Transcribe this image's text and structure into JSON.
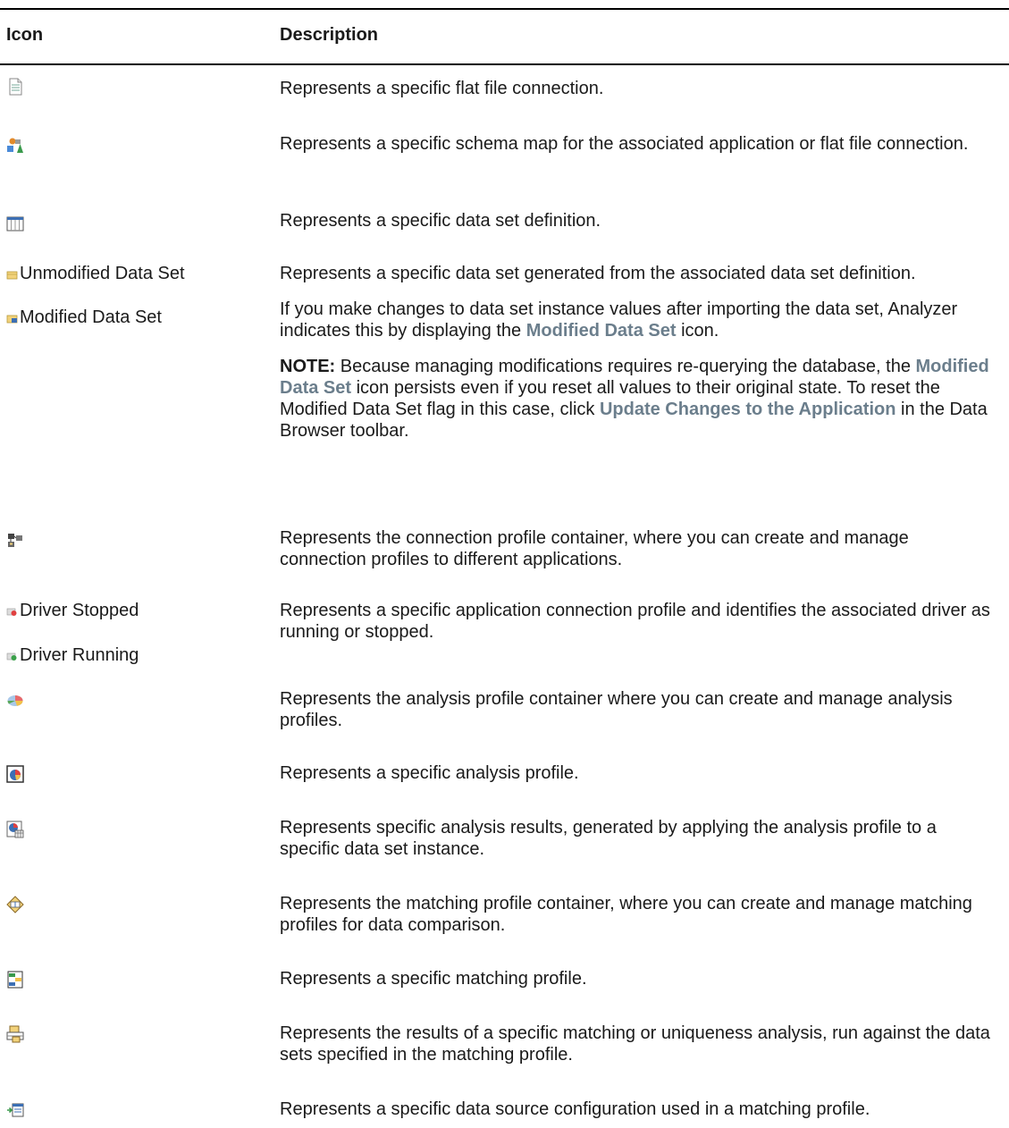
{
  "header": {
    "icon": "Icon",
    "description": "Description"
  },
  "rows": [
    {
      "icon": "flat-file-connection-icon",
      "description": "Represents a specific flat file connection."
    },
    {
      "icon": "schema-map-icon",
      "description": "Represents a specific schema map for the associated application or flat file connection."
    },
    {
      "icon": "data-set-definition-icon",
      "description": "Represents a specific data set definition."
    },
    {
      "labels": [
        "Unmodified Data Set",
        "Modified Data Set"
      ],
      "description": "Represents a specific data set generated from the associated data set definition.",
      "para2": {
        "before": "If you make changes to data set instance values after importing the data set, Analyzer indicates this by displaying the ",
        "link": "Modified Data Set",
        "after": " icon."
      },
      "note": {
        "label": "NOTE:",
        "t1": " Because managing modifications requires re-querying the database, the ",
        "link1": "Modified Data Set",
        "t2": " icon persists even if you reset all values to their original state. To reset the Modified Data Set flag in this case, click ",
        "link2": "Update Changes to the Application",
        "t3": " in the Data Browser toolbar."
      }
    },
    {
      "icon": "connection-profile-container-icon",
      "description": "Represents the connection profile container, where you can create and manage connection profiles to different applications."
    },
    {
      "labels": [
        "Driver Stopped",
        "Driver Running"
      ],
      "description": "Represents a specific application connection profile and identifies the associated driver as running or stopped."
    },
    {
      "icon": "analysis-profile-container-icon",
      "description": "Represents the analysis profile container where you can create and manage analysis profiles."
    },
    {
      "icon": "analysis-profile-icon",
      "description": "Represents a specific analysis profile."
    },
    {
      "icon": "analysis-results-icon",
      "description": "Represents specific analysis results, generated by applying the analysis profile to a specific data set instance."
    },
    {
      "icon": "matching-profile-container-icon",
      "description": "Represents the matching profile container, where you can create and manage matching profiles for data comparison."
    },
    {
      "icon": "matching-profile-icon",
      "description": "Represents a specific matching profile."
    },
    {
      "icon": "matching-results-icon",
      "description": "Represents the results of a specific matching or uniqueness analysis, run against the data sets specified in the matching profile."
    },
    {
      "icon": "data-source-configuration-icon",
      "description": "Represents a specific data source configuration used in a matching profile."
    }
  ]
}
